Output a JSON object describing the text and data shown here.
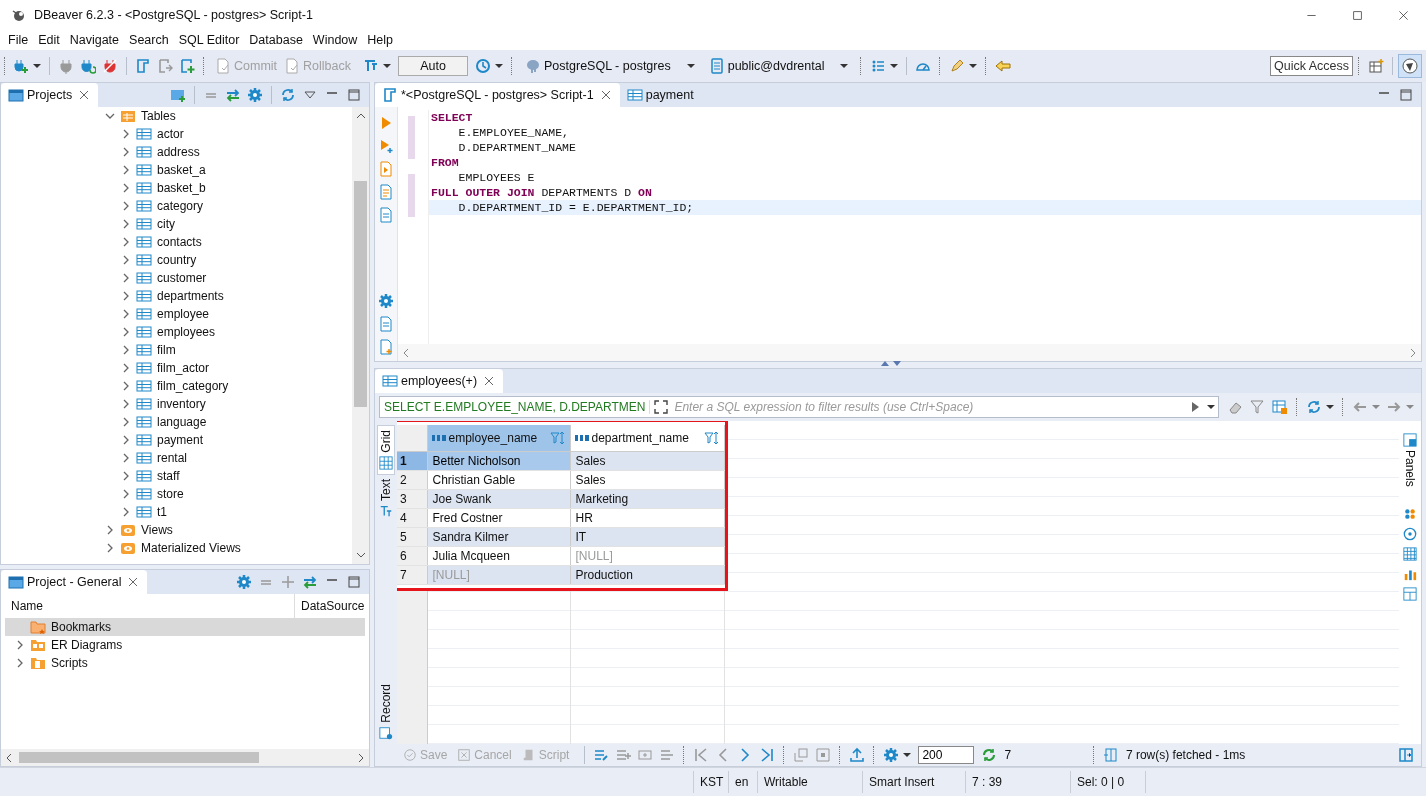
{
  "window": {
    "title": "DBeaver 6.2.3 - <PostgreSQL - postgres> Script-1"
  },
  "menu": [
    "File",
    "Edit",
    "Navigate",
    "Search",
    "SQL Editor",
    "Database",
    "Window",
    "Help"
  ],
  "toolbar": {
    "buttons": [
      {
        "label": "Commit",
        "disabled": true
      },
      {
        "label": "Rollback",
        "disabled": true
      }
    ],
    "mode": "Auto",
    "connection": "PostgreSQL - postgres",
    "schema": "public@dvdrental",
    "quick_access": "Quick Access"
  },
  "projects_panel": {
    "title": "Projects",
    "tree": [
      {
        "label": "Tables",
        "expanded": true,
        "kind": "folder",
        "children": [
          {
            "label": "actor"
          },
          {
            "label": "address"
          },
          {
            "label": "basket_a"
          },
          {
            "label": "basket_b"
          },
          {
            "label": "category"
          },
          {
            "label": "city"
          },
          {
            "label": "contacts"
          },
          {
            "label": "country"
          },
          {
            "label": "customer"
          },
          {
            "label": "departments"
          },
          {
            "label": "employee"
          },
          {
            "label": "employees"
          },
          {
            "label": "film"
          },
          {
            "label": "film_actor"
          },
          {
            "label": "film_category"
          },
          {
            "label": "inventory"
          },
          {
            "label": "language"
          },
          {
            "label": "payment"
          },
          {
            "label": "rental"
          },
          {
            "label": "staff"
          },
          {
            "label": "store"
          },
          {
            "label": "t1"
          }
        ]
      },
      {
        "label": "Views",
        "expanded": false,
        "kind": "view"
      },
      {
        "label": "Materialized Views",
        "expanded": false,
        "kind": "view"
      }
    ]
  },
  "project_panel": {
    "title": "Project - General",
    "columns": [
      "Name",
      "DataSource"
    ],
    "items": [
      {
        "label": "Bookmarks",
        "kind": "bookmarks",
        "expandable": false,
        "selected": true
      },
      {
        "label": "ER Diagrams",
        "kind": "diagrams",
        "expandable": true,
        "selected": false
      },
      {
        "label": "Scripts",
        "kind": "scripts",
        "expandable": true,
        "selected": false
      }
    ]
  },
  "editor_tabs": [
    {
      "label": "*<PostgreSQL - postgres> Script-1",
      "kind": "script",
      "selected": true
    },
    {
      "label": "payment",
      "kind": "table",
      "selected": false
    }
  ],
  "sql_lines": [
    {
      "current": false,
      "tokens": [
        {
          "kind": "keyword",
          "text": "SELECT"
        }
      ]
    },
    {
      "current": false,
      "tokens": [
        {
          "kind": "plain",
          "text": "    E.EMPLOYEE_NAME,"
        }
      ]
    },
    {
      "current": false,
      "tokens": [
        {
          "kind": "plain",
          "text": "    D.DEPARTMENT_NAME"
        }
      ]
    },
    {
      "current": false,
      "tokens": [
        {
          "kind": "keyword",
          "text": "FROM"
        }
      ]
    },
    {
      "current": false,
      "tokens": [
        {
          "kind": "plain",
          "text": "    EMPLOYEES E"
        }
      ]
    },
    {
      "current": false,
      "tokens": [
        {
          "kind": "keyword",
          "text": "FULL OUTER JOIN"
        },
        {
          "kind": "plain",
          "text": " DEPARTMENTS D "
        },
        {
          "kind": "keyword",
          "text": "ON"
        }
      ]
    },
    {
      "current": true,
      "tokens": [
        {
          "kind": "plain",
          "text": "    D.DEPARTMENT_ID = E.DEPARTMENT_ID;"
        }
      ]
    }
  ],
  "results": {
    "tab": "employees(+)",
    "query": "SELECT E.EMPLOYEE_NAME, D.DEPARTMEN",
    "filter_placeholder": "Enter a SQL expression to filter results (use Ctrl+Space)",
    "side_tabs": [
      {
        "label": "Grid",
        "selected": true
      },
      {
        "label": "Text",
        "selected": false
      }
    ],
    "record": "Record",
    "panels": "Panels",
    "columns": [
      "employee_name",
      "department_name"
    ],
    "rows": [
      {
        "number": "1",
        "selected": true,
        "cells": [
          {
            "text": "Better Nicholson",
            "null": false
          },
          {
            "text": "Sales",
            "null": false
          }
        ]
      },
      {
        "number": "2",
        "selected": false,
        "cells": [
          {
            "text": "Christian Gable",
            "null": false
          },
          {
            "text": "Sales",
            "null": false
          }
        ]
      },
      {
        "number": "3",
        "selected": false,
        "cells": [
          {
            "text": "Joe Swank",
            "null": false
          },
          {
            "text": "Marketing",
            "null": false
          }
        ]
      },
      {
        "number": "4",
        "selected": false,
        "cells": [
          {
            "text": "Fred Costner",
            "null": false
          },
          {
            "text": "HR",
            "null": false
          }
        ]
      },
      {
        "number": "5",
        "selected": false,
        "cells": [
          {
            "text": "Sandra Kilmer",
            "null": false
          },
          {
            "text": "IT",
            "null": false
          }
        ]
      },
      {
        "number": "6",
        "selected": false,
        "cells": [
          {
            "text": "Julia Mcqueen",
            "null": false
          },
          {
            "text": "[NULL]",
            "null": true
          }
        ]
      },
      {
        "number": "7",
        "selected": false,
        "cells": [
          {
            "text": "[NULL]",
            "null": true
          },
          {
            "text": "Production",
            "null": false
          }
        ]
      }
    ],
    "footer": {
      "buttons": [
        {
          "label": "Save",
          "disabled": true
        },
        {
          "label": "Cancel",
          "disabled": true
        },
        {
          "label": "Script",
          "disabled": true
        }
      ],
      "limit": "200",
      "count": "7",
      "status": "7 row(s) fetched - 1ms"
    }
  },
  "status_bar": [
    "KST",
    "en",
    "Writable",
    "Smart Insert",
    "7 : 39",
    "Sel: 0 | 0"
  ]
}
